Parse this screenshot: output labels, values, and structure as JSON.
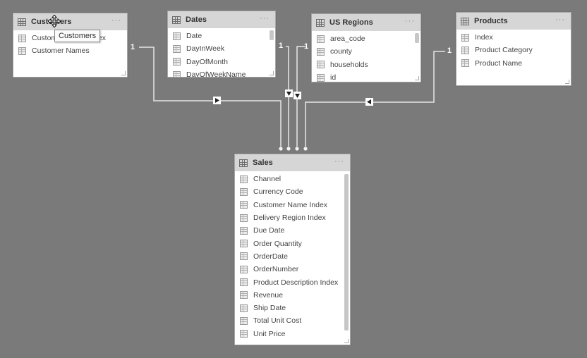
{
  "tables": {
    "customers": {
      "title": "Customers",
      "fields": [
        "Customer Name Index",
        "Customer Names"
      ],
      "tooltip": "Customers"
    },
    "dates": {
      "title": "Dates",
      "fields": [
        "Date",
        "DayInWeek",
        "DayOfMonth",
        "DayOfWeekName"
      ]
    },
    "us_regions": {
      "title": "US Regions",
      "fields": [
        "area_code",
        "county",
        "households",
        "id"
      ]
    },
    "products": {
      "title": "Products",
      "fields": [
        "Index",
        "Product Category",
        "Product Name"
      ]
    },
    "sales": {
      "title": "Sales",
      "fields": [
        "Channel",
        "Currency Code",
        "Customer Name Index",
        "Delivery Region Index",
        "Due Date",
        "Order Quantity",
        "OrderDate",
        "OrderNumber",
        "Product Description Index",
        "Revenue",
        "Ship Date",
        "Total Unit Cost",
        "Unit Price"
      ]
    }
  },
  "relationships": [
    {
      "from": "Customers",
      "to": "Sales",
      "one_side_label": "1",
      "many_side_label": "*",
      "filter_direction": "right"
    },
    {
      "from": "Dates",
      "to": "Sales",
      "one_side_label": "1",
      "many_side_label": "*",
      "filter_direction": "down"
    },
    {
      "from": "US Regions",
      "to": "Sales",
      "one_side_label": "1",
      "many_side_label": "*",
      "filter_direction": "down"
    },
    {
      "from": "Products",
      "to": "Sales",
      "one_side_label": "1",
      "many_side_label": "*",
      "filter_direction": "left"
    }
  ],
  "more_label": "···"
}
